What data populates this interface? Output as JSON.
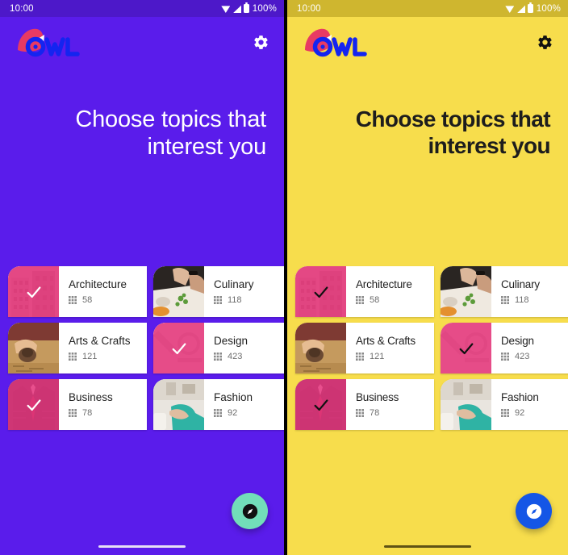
{
  "panels": [
    {
      "id": "left",
      "theme_name": "purple-theme",
      "background_color": "#5a1ceb",
      "statusbar": {
        "time": "10:00",
        "battery_percent": "100%",
        "icons": [
          "wifi-icon",
          "signal-icon",
          "battery-icon"
        ]
      },
      "appbar": {
        "logo_text": "OWL",
        "logo_name": "owl-logo",
        "settings_icon": "gear-icon"
      },
      "title": "Choose topics that interest you",
      "topics": [
        {
          "label": "Architecture",
          "count": "58",
          "selected": true,
          "thumb": "architecture-photo"
        },
        {
          "label": "Culinary",
          "count": "118",
          "selected": false,
          "thumb": "culinary-photo"
        },
        {
          "label": "Arts & Crafts",
          "count": "121",
          "selected": false,
          "thumb": "arts-crafts-photo"
        },
        {
          "label": "Design",
          "count": "423",
          "selected": true,
          "thumb": "design-photo"
        },
        {
          "label": "Business",
          "count": "78",
          "selected": true,
          "thumb": "business-photo"
        },
        {
          "label": "Fashion",
          "count": "92",
          "selected": false,
          "thumb": "fashion-photo"
        }
      ],
      "peek_topics": [
        {
          "thumb": "peek-photo-1"
        },
        {
          "thumb": "peek-photo-2"
        },
        {
          "thumb": "peek-photo-3"
        }
      ],
      "fab": {
        "icon": "compass-icon",
        "color": "#72deb9",
        "icon_color": "#111111"
      },
      "check_color": "#ffffff"
    },
    {
      "id": "right",
      "theme_name": "yellow-theme",
      "background_color": "#f7dd4c",
      "statusbar": {
        "time": "10:00",
        "battery_percent": "100%",
        "icons": [
          "wifi-icon",
          "signal-icon",
          "battery-icon"
        ]
      },
      "appbar": {
        "logo_text": "OWL",
        "logo_name": "owl-logo",
        "settings_icon": "gear-icon"
      },
      "title": "Choose topics that interest you",
      "topics": [
        {
          "label": "Architecture",
          "count": "58",
          "selected": true,
          "thumb": "architecture-photo"
        },
        {
          "label": "Culinary",
          "count": "118",
          "selected": false,
          "thumb": "culinary-photo"
        },
        {
          "label": "Arts & Crafts",
          "count": "121",
          "selected": false,
          "thumb": "arts-crafts-photo"
        },
        {
          "label": "Design",
          "count": "423",
          "selected": true,
          "thumb": "design-photo"
        },
        {
          "label": "Business",
          "count": "78",
          "selected": true,
          "thumb": "business-photo"
        },
        {
          "label": "Fashion",
          "count": "92",
          "selected": false,
          "thumb": "fashion-photo"
        }
      ],
      "peek_topics": [
        {
          "thumb": "peek-photo-1"
        },
        {
          "thumb": "peek-photo-2"
        },
        {
          "thumb": "peek-photo-3"
        }
      ],
      "fab": {
        "icon": "compass-icon",
        "color": "#1456e6",
        "icon_color": "#ffffff"
      },
      "check_color": "#111111"
    }
  ],
  "shared": {
    "count_icon": "grid-icon",
    "selected_overlay_color": "#e8367e",
    "logo_mark_color": "#e83a63",
    "logo_text_color": "#1424f0"
  }
}
